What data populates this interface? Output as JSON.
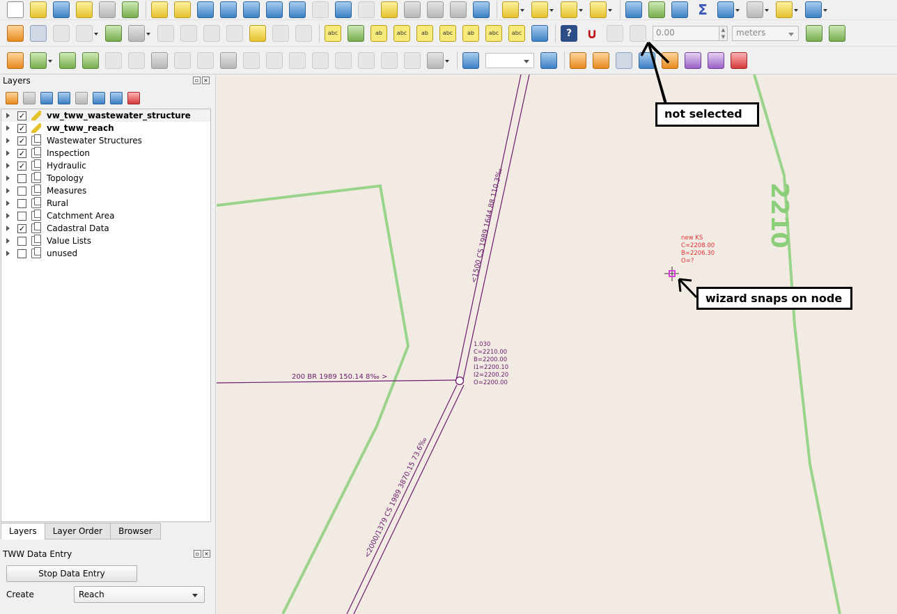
{
  "snapping": {
    "tolerance_value": "0.00",
    "tolerance_unit": "meters"
  },
  "layers_panel": {
    "title": "Layers",
    "layers": [
      {
        "label": "vw_tww_wastewater_structure",
        "checked": true,
        "bold": true,
        "editable": true
      },
      {
        "label": "vw_tww_reach",
        "checked": true,
        "bold": true,
        "editable": true
      },
      {
        "label": "Wastewater Structures",
        "checked": true,
        "bold": false,
        "editable": false
      },
      {
        "label": "Inspection",
        "checked": true,
        "bold": false,
        "editable": false
      },
      {
        "label": "Hydraulic",
        "checked": true,
        "bold": false,
        "editable": false
      },
      {
        "label": "Topology",
        "checked": false,
        "bold": false,
        "editable": false
      },
      {
        "label": "Measures",
        "checked": false,
        "bold": false,
        "editable": false
      },
      {
        "label": "Rural",
        "checked": false,
        "bold": false,
        "editable": false
      },
      {
        "label": "Catchment Area",
        "checked": false,
        "bold": false,
        "editable": false
      },
      {
        "label": "Cadastral Data",
        "checked": true,
        "bold": false,
        "editable": false
      },
      {
        "label": "Value Lists",
        "checked": false,
        "bold": false,
        "editable": false
      },
      {
        "label": "unused",
        "checked": false,
        "bold": false,
        "editable": false
      }
    ],
    "tabs": [
      "Layers",
      "Layer Order",
      "Browser"
    ]
  },
  "data_entry": {
    "title": "TWW Data Entry",
    "stop_button": "Stop Data Entry",
    "create_label": "Create",
    "create_value": "Reach"
  },
  "map": {
    "reach_top_label": "<1500 CS 1989 1644.88 110.3‰",
    "reach_bottom_label": "<2000/1379 CS 1989 3870.15 73.6‰",
    "reach_left_label": "200 BR 1989 150.14 8‰  >",
    "node_labels": [
      "1.030",
      "C=2210.00",
      "B=2200.00",
      "I1=2200.10",
      "I2=2200.20",
      "O=2200.00"
    ],
    "new_node_labels": [
      "new KS",
      "C=2208.00",
      "B=2206.30",
      "O=?"
    ],
    "contour_label": "2210",
    "callout_not_selected": "not selected",
    "callout_wizard": "wizard snaps on node"
  },
  "colors": {
    "reach": "#6a1b6a",
    "contour": "#8bcf7b",
    "new_node": "#e03030",
    "map_bg": "#f1ebe4"
  }
}
